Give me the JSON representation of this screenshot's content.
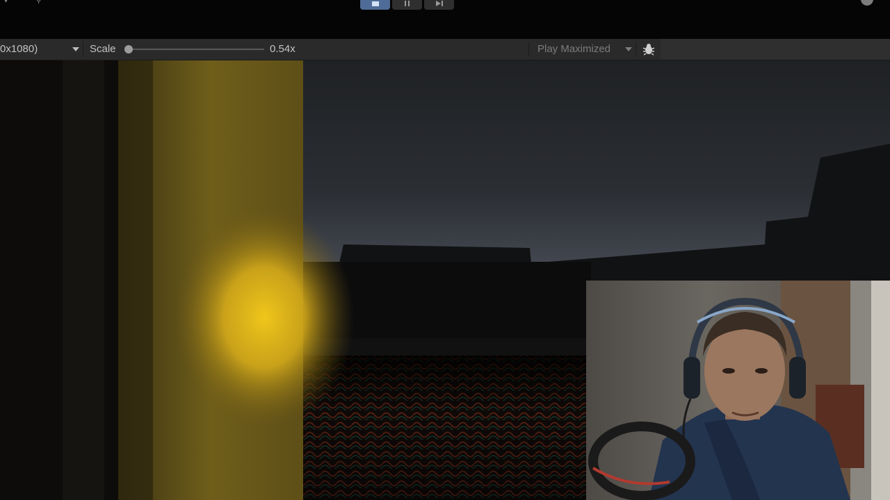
{
  "toolbar": {
    "play_button": "play",
    "pause_button": "pause",
    "step_button": "step"
  },
  "game_view": {
    "resolution_label": "0x1080)",
    "scale_label": "Scale",
    "scale_value": "0.54x",
    "scale_fraction": 0.0,
    "play_mode": "Play Maximized"
  },
  "icons": {
    "bug": "bug-icon",
    "account": "account-icon",
    "dropdown": "chevron-down-icon"
  },
  "colors": {
    "active_button": "#4f6b97",
    "toolbar_bg": "#2a2a2a",
    "wall_yellow": "#b79a1e"
  }
}
